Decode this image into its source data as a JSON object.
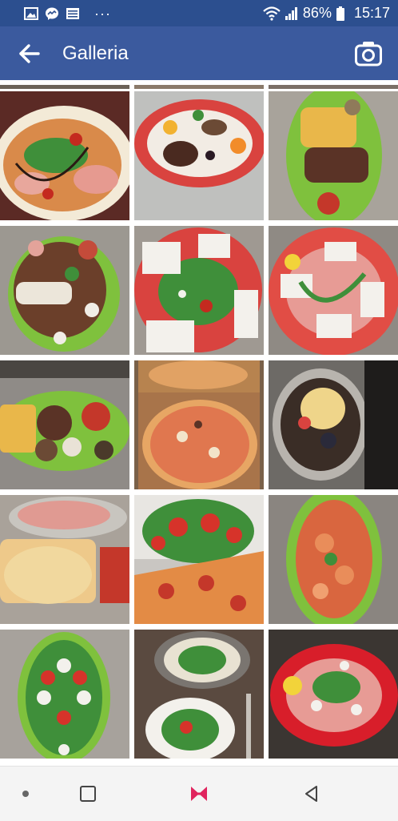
{
  "status_bar": {
    "battery": "86%",
    "time": "15:17",
    "more": "···"
  },
  "app_bar": {
    "title": "Galleria"
  },
  "icons": {
    "back": "back-arrow-icon",
    "camera": "camera-icon",
    "gallery_notification": "image-icon",
    "messenger_notification": "messenger-icon",
    "news_notification": "news-icon",
    "wifi": "wifi-icon",
    "signal": "signal-icon",
    "battery": "battery-icon"
  },
  "colors": {
    "status_bar": "#2c4f8f",
    "app_bar": "#3b5a9e",
    "nav_accent": "#e0245e"
  },
  "gallery": {
    "photos": [
      {
        "subject": "pizza-with-prosciutto-and-salad"
      },
      {
        "subject": "grilled-meat-plate-with-fruit"
      },
      {
        "subject": "steak-with-fries-on-green-plate"
      },
      {
        "subject": "antipasto-platter-with-bread"
      },
      {
        "subject": "caprese-salad-red-plate"
      },
      {
        "subject": "carpaccio-with-parmesan"
      },
      {
        "subject": "mixed-grill-with-fries"
      },
      {
        "subject": "pizza-in-box"
      },
      {
        "subject": "spaghetti-with-seafood-pan"
      },
      {
        "subject": "cold-cuts-and-fried-dough"
      },
      {
        "subject": "tomato-salad-and-salami-pizza"
      },
      {
        "subject": "shrimp-platter-green-plate"
      },
      {
        "subject": "caprese-salad-green-plate"
      },
      {
        "subject": "salads-on-white-plates"
      },
      {
        "subject": "carpaccio-salad-red-plate"
      }
    ]
  }
}
